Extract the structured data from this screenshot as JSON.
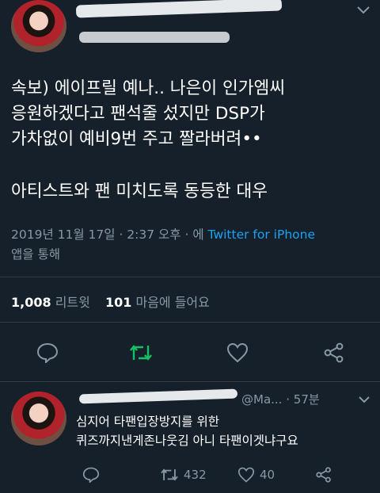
{
  "tweet": {
    "body_lines": [
      "속보) 에이프릴 예나.. 나은이 인가엠씨",
      "응원하겠다고 팬석줄 섰지만 DSP가",
      "가차없이 예비9번 주고 짤라버려••"
    ],
    "body_line_last": "아티스트와 팬 미치도록 동등한 대우",
    "timestamp": "2019년 11월 17일 · 2:37 오후 · 에",
    "source": "Twitter for iPhone",
    "source_suffix": "앱을 통해",
    "retweets_count": "1,008",
    "retweets_label": "리트윗",
    "likes_count": "101",
    "likes_label": "마음에 들어요"
  },
  "reply": {
    "handle_partial": "@Ma...",
    "time": "· 57분",
    "text_lines": [
      "심지어 타팬입장방지를 위한",
      "퀴즈까지낸게존나웃김 아니 타팬이겟냐구요"
    ],
    "retweets": "432",
    "likes": "40"
  },
  "icons": {
    "reply": "speech-bubble-icon",
    "retweet": "retweet-icon",
    "like": "heart-icon",
    "share": "share-icon",
    "menu": "chevron-down-icon"
  },
  "colors": {
    "background": "#15202b",
    "text": "#ffffff",
    "secondary": "#8899a6",
    "link": "#1da1f2",
    "retweet_active": "#17bf63"
  }
}
